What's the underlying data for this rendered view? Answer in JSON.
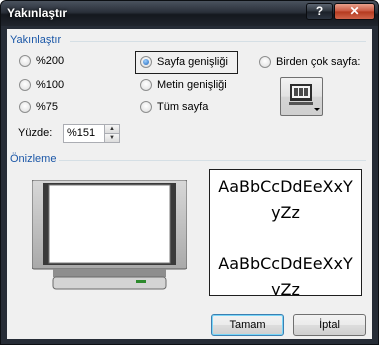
{
  "window": {
    "title": "Yakınlaştır",
    "help_label": "?",
    "close_label": "✕"
  },
  "zoom_group": {
    "label": "Yakınlaştır",
    "options": [
      {
        "label": "%200",
        "checked": false
      },
      {
        "label": "%100",
        "checked": false
      },
      {
        "label": "%75",
        "checked": false
      },
      {
        "label": "Sayfa genişliği",
        "checked": true
      },
      {
        "label": "Metin genişliği",
        "checked": false
      },
      {
        "label": "Tüm sayfa",
        "checked": false
      },
      {
        "label": "Birden çok sayfa:",
        "checked": false
      }
    ],
    "percent_label": "Yüzde:",
    "percent_value": "%151",
    "multi_page_icon": "monitor-pages-icon"
  },
  "preview_group": {
    "label": "Önizleme",
    "sample_lines": [
      "AaBbCcDdEeXxY",
      "yZz",
      "AaBbCcDdEeXxY",
      "yZz"
    ]
  },
  "buttons": {
    "ok": "Tamam",
    "cancel": "İptal"
  },
  "colors": {
    "accent": "#1b57a7",
    "titlebar": "#262c36",
    "close": "#c8553d"
  }
}
